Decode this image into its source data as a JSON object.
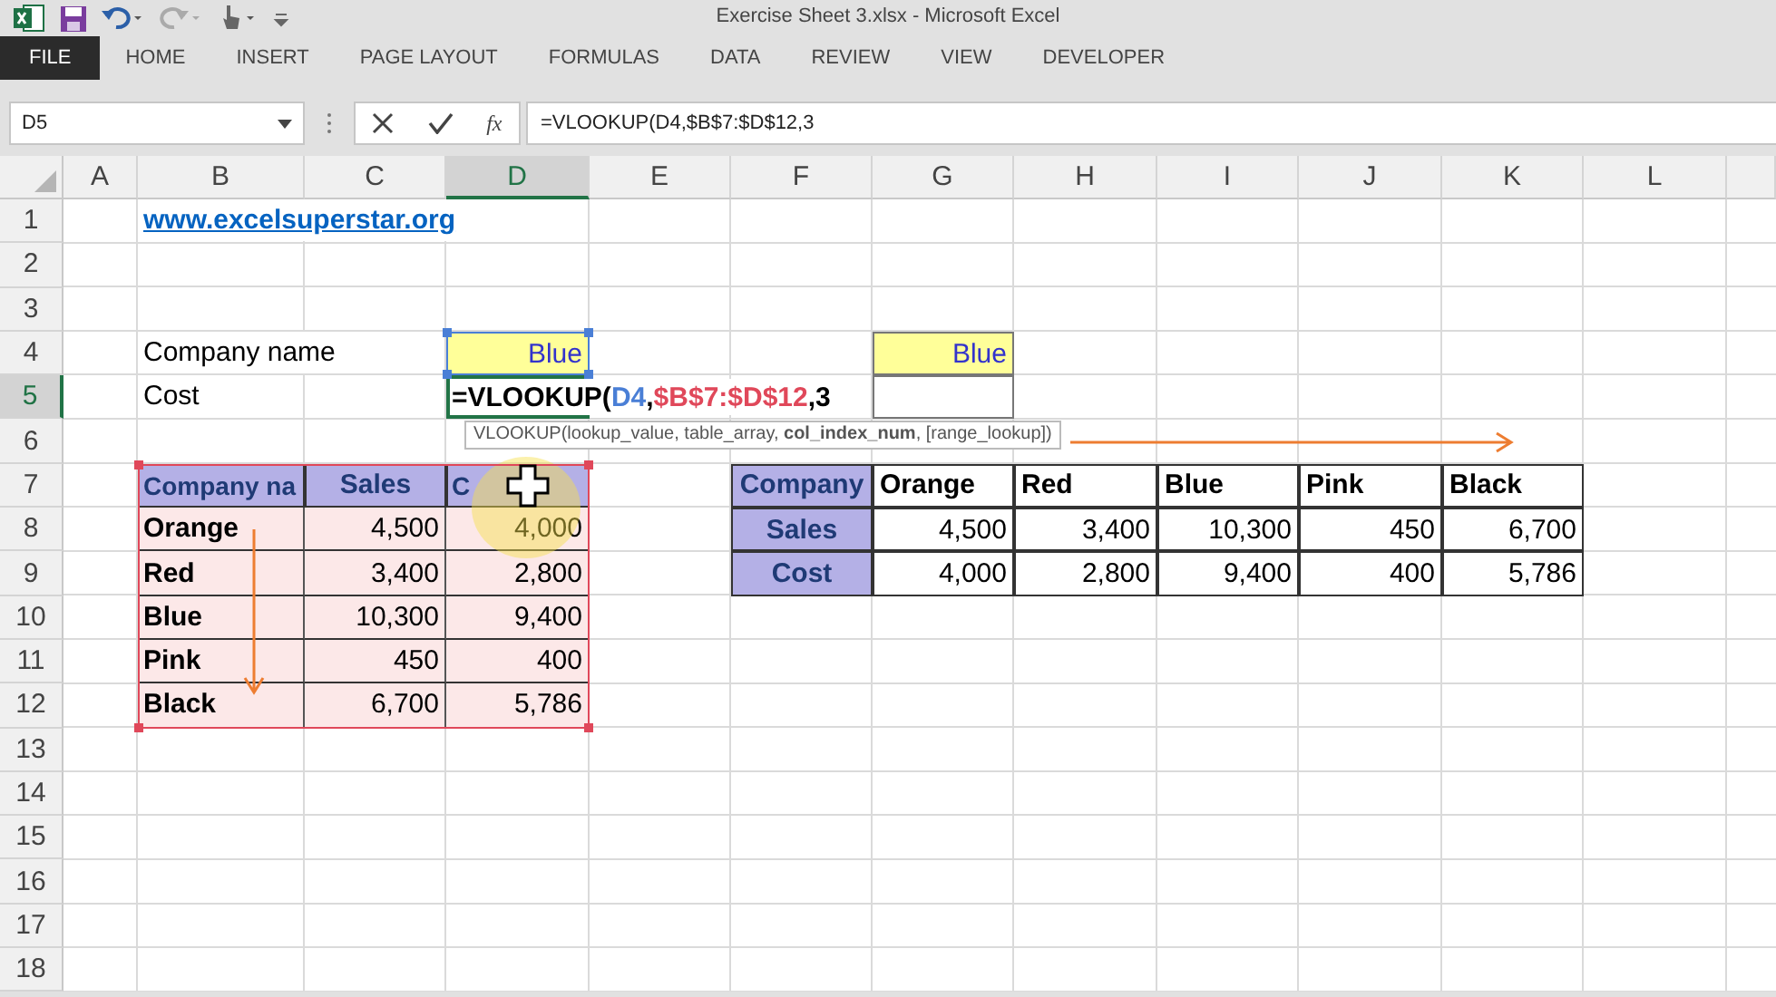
{
  "window": {
    "title": "Exercise Sheet 3.xlsx - Microsoft Excel"
  },
  "ribbon_tabs": [
    {
      "label": "FILE",
      "selected": true
    },
    {
      "label": "HOME",
      "selected": false
    },
    {
      "label": "INSERT",
      "selected": false
    },
    {
      "label": "PAGE LAYOUT",
      "selected": false
    },
    {
      "label": "FORMULAS",
      "selected": false
    },
    {
      "label": "DATA",
      "selected": false
    },
    {
      "label": "REVIEW",
      "selected": false
    },
    {
      "label": "VIEW",
      "selected": false
    },
    {
      "label": "DEVELOPER",
      "selected": false
    }
  ],
  "name_box": "D5",
  "formula_bar": {
    "fx": "fx",
    "value": "=VLOOKUP(D4,$B$7:$D$12,3"
  },
  "columns": [
    {
      "label": "A",
      "selected": false
    },
    {
      "label": "B",
      "selected": false
    },
    {
      "label": "C",
      "selected": false
    },
    {
      "label": "D",
      "selected": true
    },
    {
      "label": "E",
      "selected": false
    },
    {
      "label": "F",
      "selected": false
    },
    {
      "label": "G",
      "selected": false
    },
    {
      "label": "H",
      "selected": false
    },
    {
      "label": "I",
      "selected": false
    },
    {
      "label": "J",
      "selected": false
    },
    {
      "label": "K",
      "selected": false
    },
    {
      "label": "L",
      "selected": false
    }
  ],
  "rows": [
    {
      "number": "1",
      "selected": false,
      "cells": [
        {
          "kind": "blank"
        },
        {
          "kind": "link",
          "text": "www.excelsuperstar.org"
        }
      ]
    },
    {
      "number": "2",
      "selected": false
    },
    {
      "number": "3",
      "selected": false
    },
    {
      "number": "4",
      "selected": false,
      "cells": [
        {
          "kind": "blank"
        },
        {
          "kind": "text",
          "text": "Company name"
        },
        {
          "kind": "blank"
        },
        {
          "kind": "lookup",
          "text": "Blue"
        },
        {
          "kind": "blank"
        },
        {
          "kind": "blank"
        },
        {
          "kind": "lookup",
          "text": "Blue"
        }
      ]
    },
    {
      "number": "5",
      "selected": true,
      "cells": [
        {
          "kind": "blank"
        },
        {
          "kind": "text",
          "text": "Cost"
        },
        {
          "kind": "blank"
        },
        {
          "kind": "formula",
          "active": true,
          "tooltip": "VLOOKUP(lookup_value, table_array, **col_index_num**, [range_lookup])",
          "parts": [
            {
              "kind": "plain",
              "text": "=VLOOKUP(",
              "color": "#000000"
            },
            {
              "kind": "ref",
              "text": "D4",
              "color": "#4a7fd6"
            },
            {
              "kind": "plain",
              "text": ",",
              "color": "#000000"
            },
            {
              "kind": "ref",
              "text": "$B$7:$D$12",
              "color": "#e0485a"
            },
            {
              "kind": "plain",
              "text": ",3",
              "color": "#000000"
            }
          ]
        },
        {
          "kind": "blank"
        },
        {
          "kind": "blank"
        },
        {
          "kind": "box"
        }
      ]
    },
    {
      "number": "6",
      "selected": false
    },
    {
      "number": "7",
      "selected": false,
      "cells": [
        {
          "kind": "blank"
        },
        {
          "kind": "headleft",
          "text": "Company na"
        },
        {
          "kind": "head",
          "text": "Sales"
        },
        {
          "kind": "headleft",
          "text": "C"
        },
        {
          "kind": "blank"
        },
        {
          "kind": "head",
          "text": "Company"
        },
        {
          "kind": "title",
          "text": "Orange"
        },
        {
          "kind": "title",
          "text": "Red"
        },
        {
          "kind": "title",
          "text": "Blue"
        },
        {
          "kind": "title",
          "text": "Pink"
        },
        {
          "kind": "title",
          "text": "Black"
        }
      ]
    },
    {
      "number": "8",
      "selected": false,
      "cells": [
        {
          "kind": "blank"
        },
        {
          "kind": "name",
          "text": "Orange"
        },
        {
          "kind": "tinted",
          "text": "4,500"
        },
        {
          "kind": "tinted",
          "text": "4,000"
        },
        {
          "kind": "blank"
        },
        {
          "kind": "head",
          "text": "Sales"
        },
        {
          "kind": "num",
          "text": "4,500"
        },
        {
          "kind": "num",
          "text": "3,400"
        },
        {
          "kind": "num",
          "text": "10,300"
        },
        {
          "kind": "num",
          "text": "450"
        },
        {
          "kind": "num",
          "text": "6,700"
        }
      ]
    },
    {
      "number": "9",
      "selected": false,
      "cells": [
        {
          "kind": "blank"
        },
        {
          "kind": "name",
          "text": "Red"
        },
        {
          "kind": "tinted",
          "text": "3,400"
        },
        {
          "kind": "tinted",
          "text": "2,800"
        },
        {
          "kind": "blank"
        },
        {
          "kind": "head",
          "text": "Cost"
        },
        {
          "kind": "num",
          "text": "4,000"
        },
        {
          "kind": "num",
          "text": "2,800"
        },
        {
          "kind": "num",
          "text": "9,400"
        },
        {
          "kind": "num",
          "text": "400"
        },
        {
          "kind": "num",
          "text": "5,786"
        }
      ]
    },
    {
      "number": "10",
      "selected": false,
      "cells": [
        {
          "kind": "blank"
        },
        {
          "kind": "name",
          "text": "Blue"
        },
        {
          "kind": "tinted",
          "text": "10,300"
        },
        {
          "kind": "tinted",
          "text": "9,400"
        }
      ]
    },
    {
      "number": "11",
      "selected": false,
      "cells": [
        {
          "kind": "blank"
        },
        {
          "kind": "name",
          "text": "Pink"
        },
        {
          "kind": "tinted",
          "text": "450"
        },
        {
          "kind": "tinted",
          "text": "400"
        }
      ]
    },
    {
      "number": "12",
      "selected": false,
      "cells": [
        {
          "kind": "blank"
        },
        {
          "kind": "name",
          "text": "Black"
        },
        {
          "kind": "tinted",
          "text": "6,700"
        },
        {
          "kind": "tinted",
          "text": "5,786"
        }
      ]
    },
    {
      "number": "13",
      "selected": false
    },
    {
      "number": "14",
      "selected": false
    },
    {
      "number": "15",
      "selected": false
    },
    {
      "number": "16",
      "selected": false
    },
    {
      "number": "17",
      "selected": false
    },
    {
      "number": "18",
      "selected": false
    }
  ]
}
